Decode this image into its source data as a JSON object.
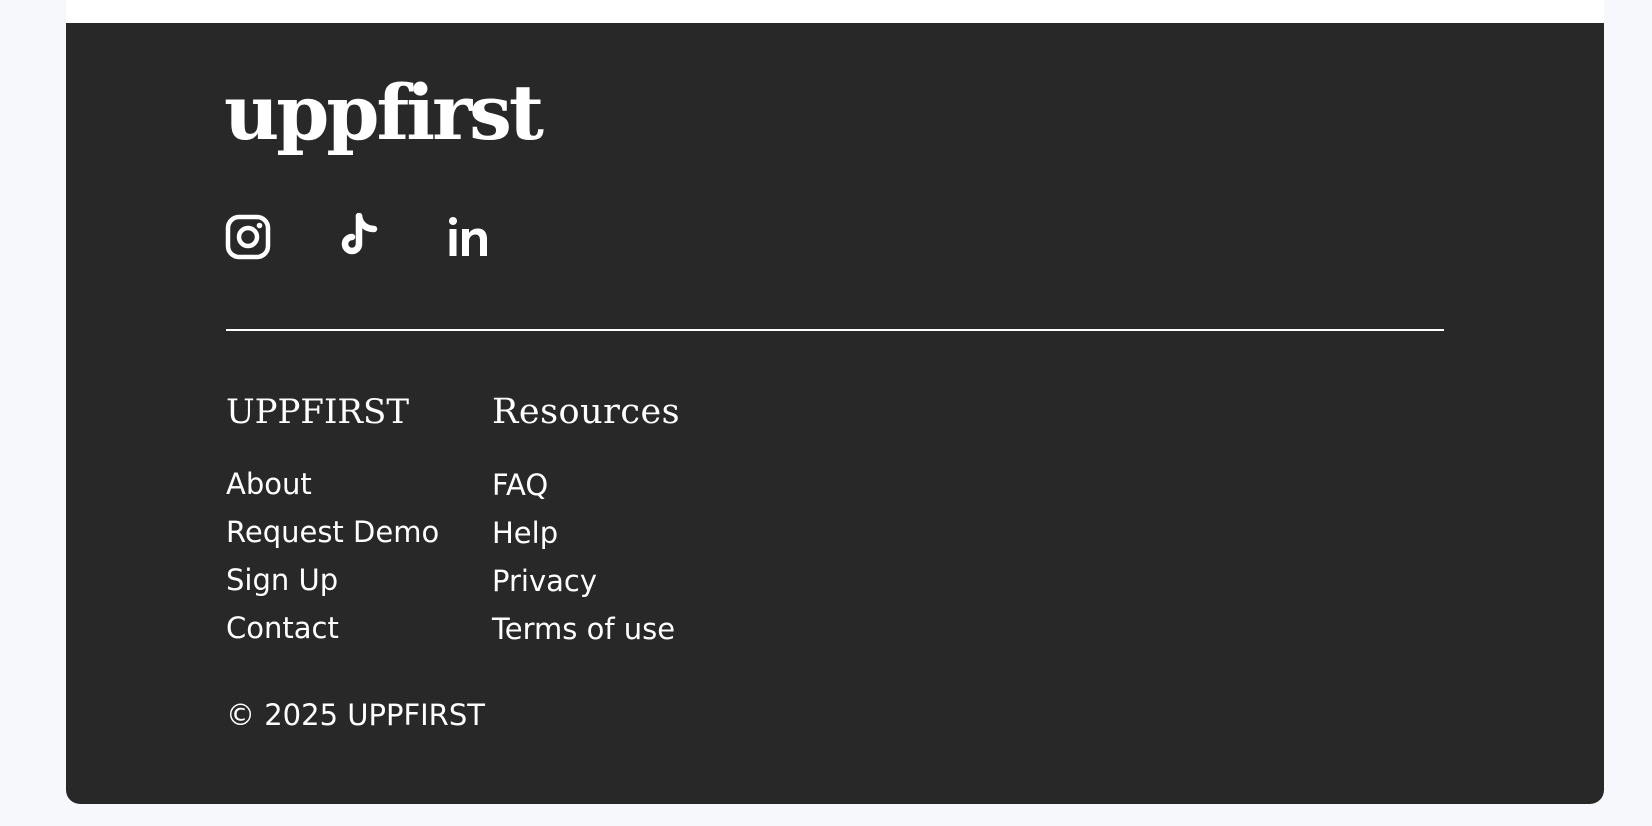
{
  "footer": {
    "logo_text": "uppfirst",
    "socials": [
      {
        "icon": "instagram-icon"
      },
      {
        "icon": "tiktok-icon"
      },
      {
        "icon": "linkedin-icon"
      }
    ],
    "columns": [
      {
        "heading": "UPPFIRST",
        "links": [
          "About",
          "Request Demo",
          "Sign Up",
          "Contact"
        ]
      },
      {
        "heading": "Resources",
        "links": [
          "FAQ",
          "Help",
          "Privacy",
          "Terms of use"
        ]
      }
    ],
    "copyright": "© 2025 UPPFIRST"
  },
  "colors": {
    "footer_background": "#282828",
    "page_background": "#f7f8fc",
    "text": "#ffffff"
  }
}
